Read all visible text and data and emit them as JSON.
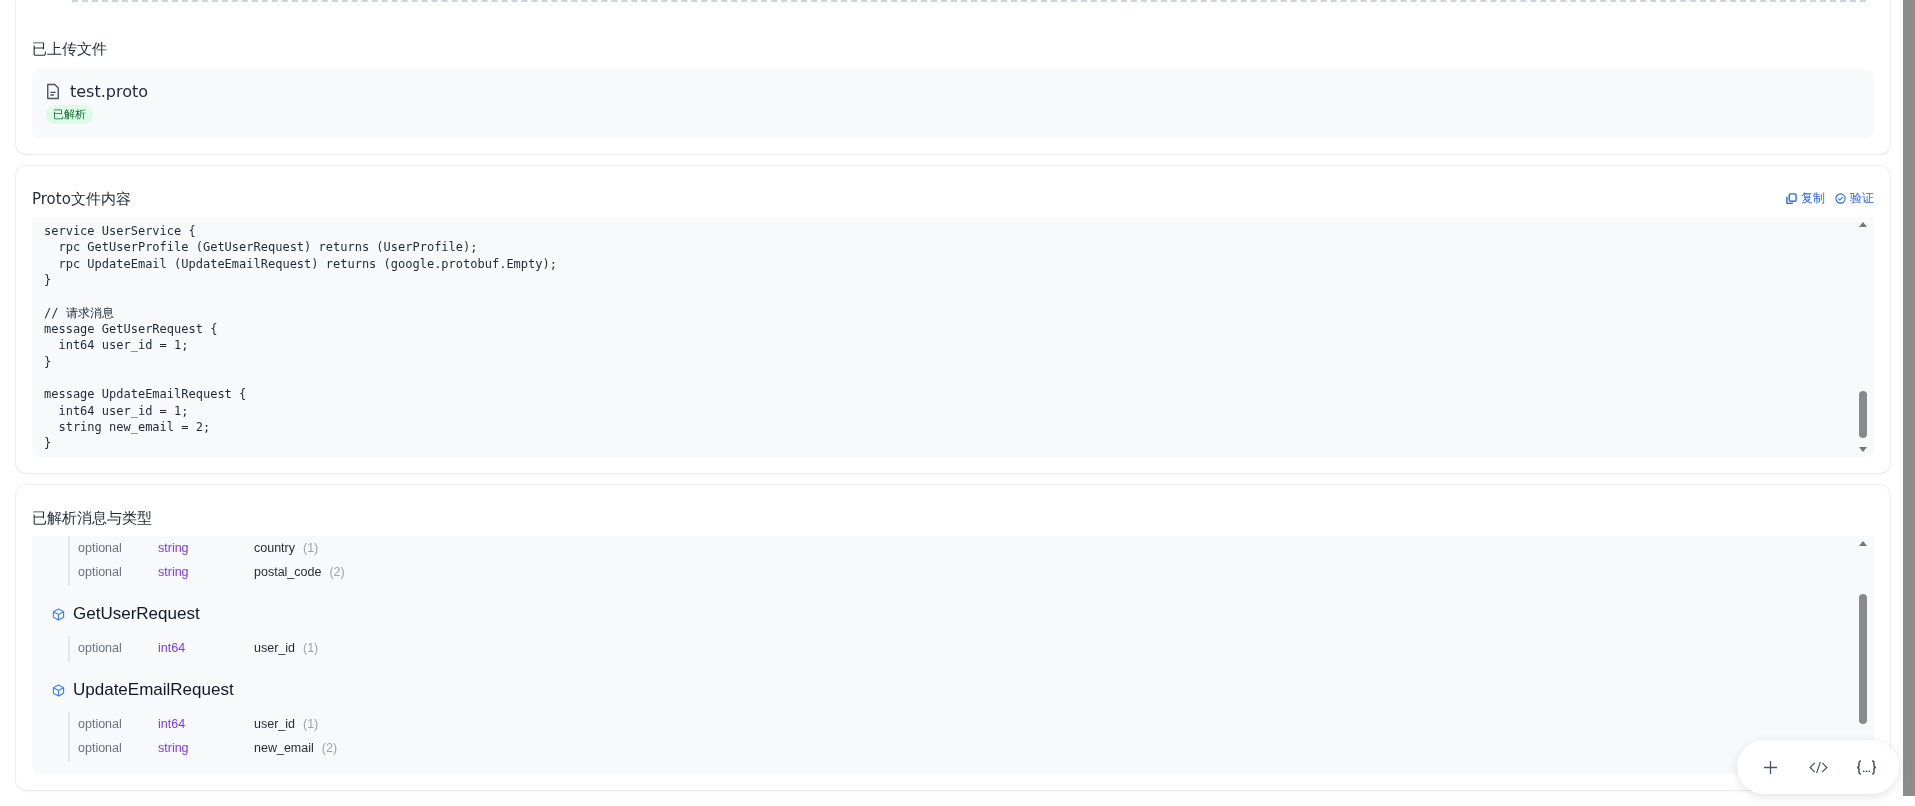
{
  "uploaded": {
    "title": "已上传文件",
    "files": [
      {
        "name": "test.proto",
        "status": "已解析"
      }
    ]
  },
  "proto": {
    "title": "Proto文件内容",
    "actions": [
      {
        "label": "复制",
        "kind": "copy"
      },
      {
        "label": "验证",
        "kind": "verify"
      }
    ],
    "blocks": [
      [
        "service UserService {",
        "  rpc GetUserProfile (GetUserRequest) returns (UserProfile);",
        "  rpc UpdateEmail (UpdateEmailRequest) returns (google.protobuf.Empty);",
        "}"
      ],
      [
        "// 请求消息",
        "message GetUserRequest {",
        "  int64 user_id = 1;",
        "}"
      ],
      [
        "message UpdateEmailRequest {",
        "  int64 user_id = 1;",
        "  string new_email = 2;",
        "}"
      ]
    ]
  },
  "parsed": {
    "title": "已解析消息与类型",
    "groups": [
      {
        "fields": [
          {
            "label": "optional",
            "type": "string",
            "name": "country",
            "number": "(1)"
          },
          {
            "label": "optional",
            "type": "string",
            "name": "postal_code",
            "number": "(2)"
          }
        ]
      },
      {
        "name": "GetUserRequest",
        "fields": [
          {
            "label": "optional",
            "type": "int64",
            "name": "user_id",
            "number": "(1)"
          }
        ]
      },
      {
        "name": "UpdateEmailRequest",
        "fields": [
          {
            "label": "optional",
            "type": "int64",
            "name": "user_id",
            "number": "(1)"
          },
          {
            "label": "optional",
            "type": "string",
            "name": "new_email",
            "number": "(2)"
          }
        ]
      }
    ]
  }
}
